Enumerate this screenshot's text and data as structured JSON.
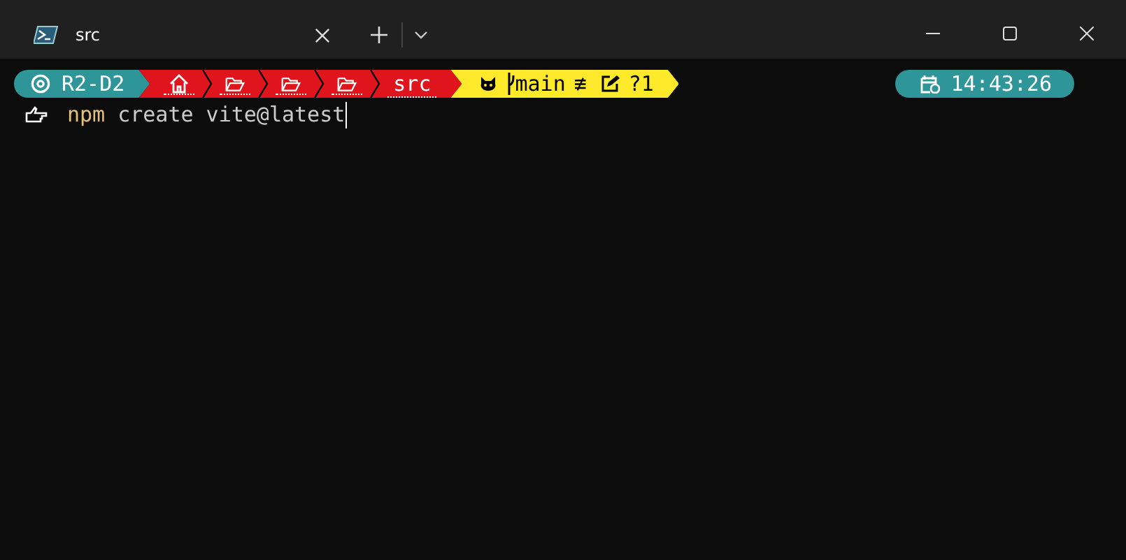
{
  "tab": {
    "title": "src"
  },
  "prompt": {
    "host": "R2-D2",
    "path": [
      {
        "kind": "home"
      },
      {
        "kind": "folder"
      },
      {
        "kind": "folder"
      },
      {
        "kind": "folder"
      },
      {
        "kind": "text",
        "label": "src"
      }
    ],
    "git": {
      "branch": "main",
      "status": "≢",
      "changes": "?1"
    },
    "time": "14:43:26"
  },
  "command": {
    "program": "npm",
    "args": "create vite@latest"
  }
}
